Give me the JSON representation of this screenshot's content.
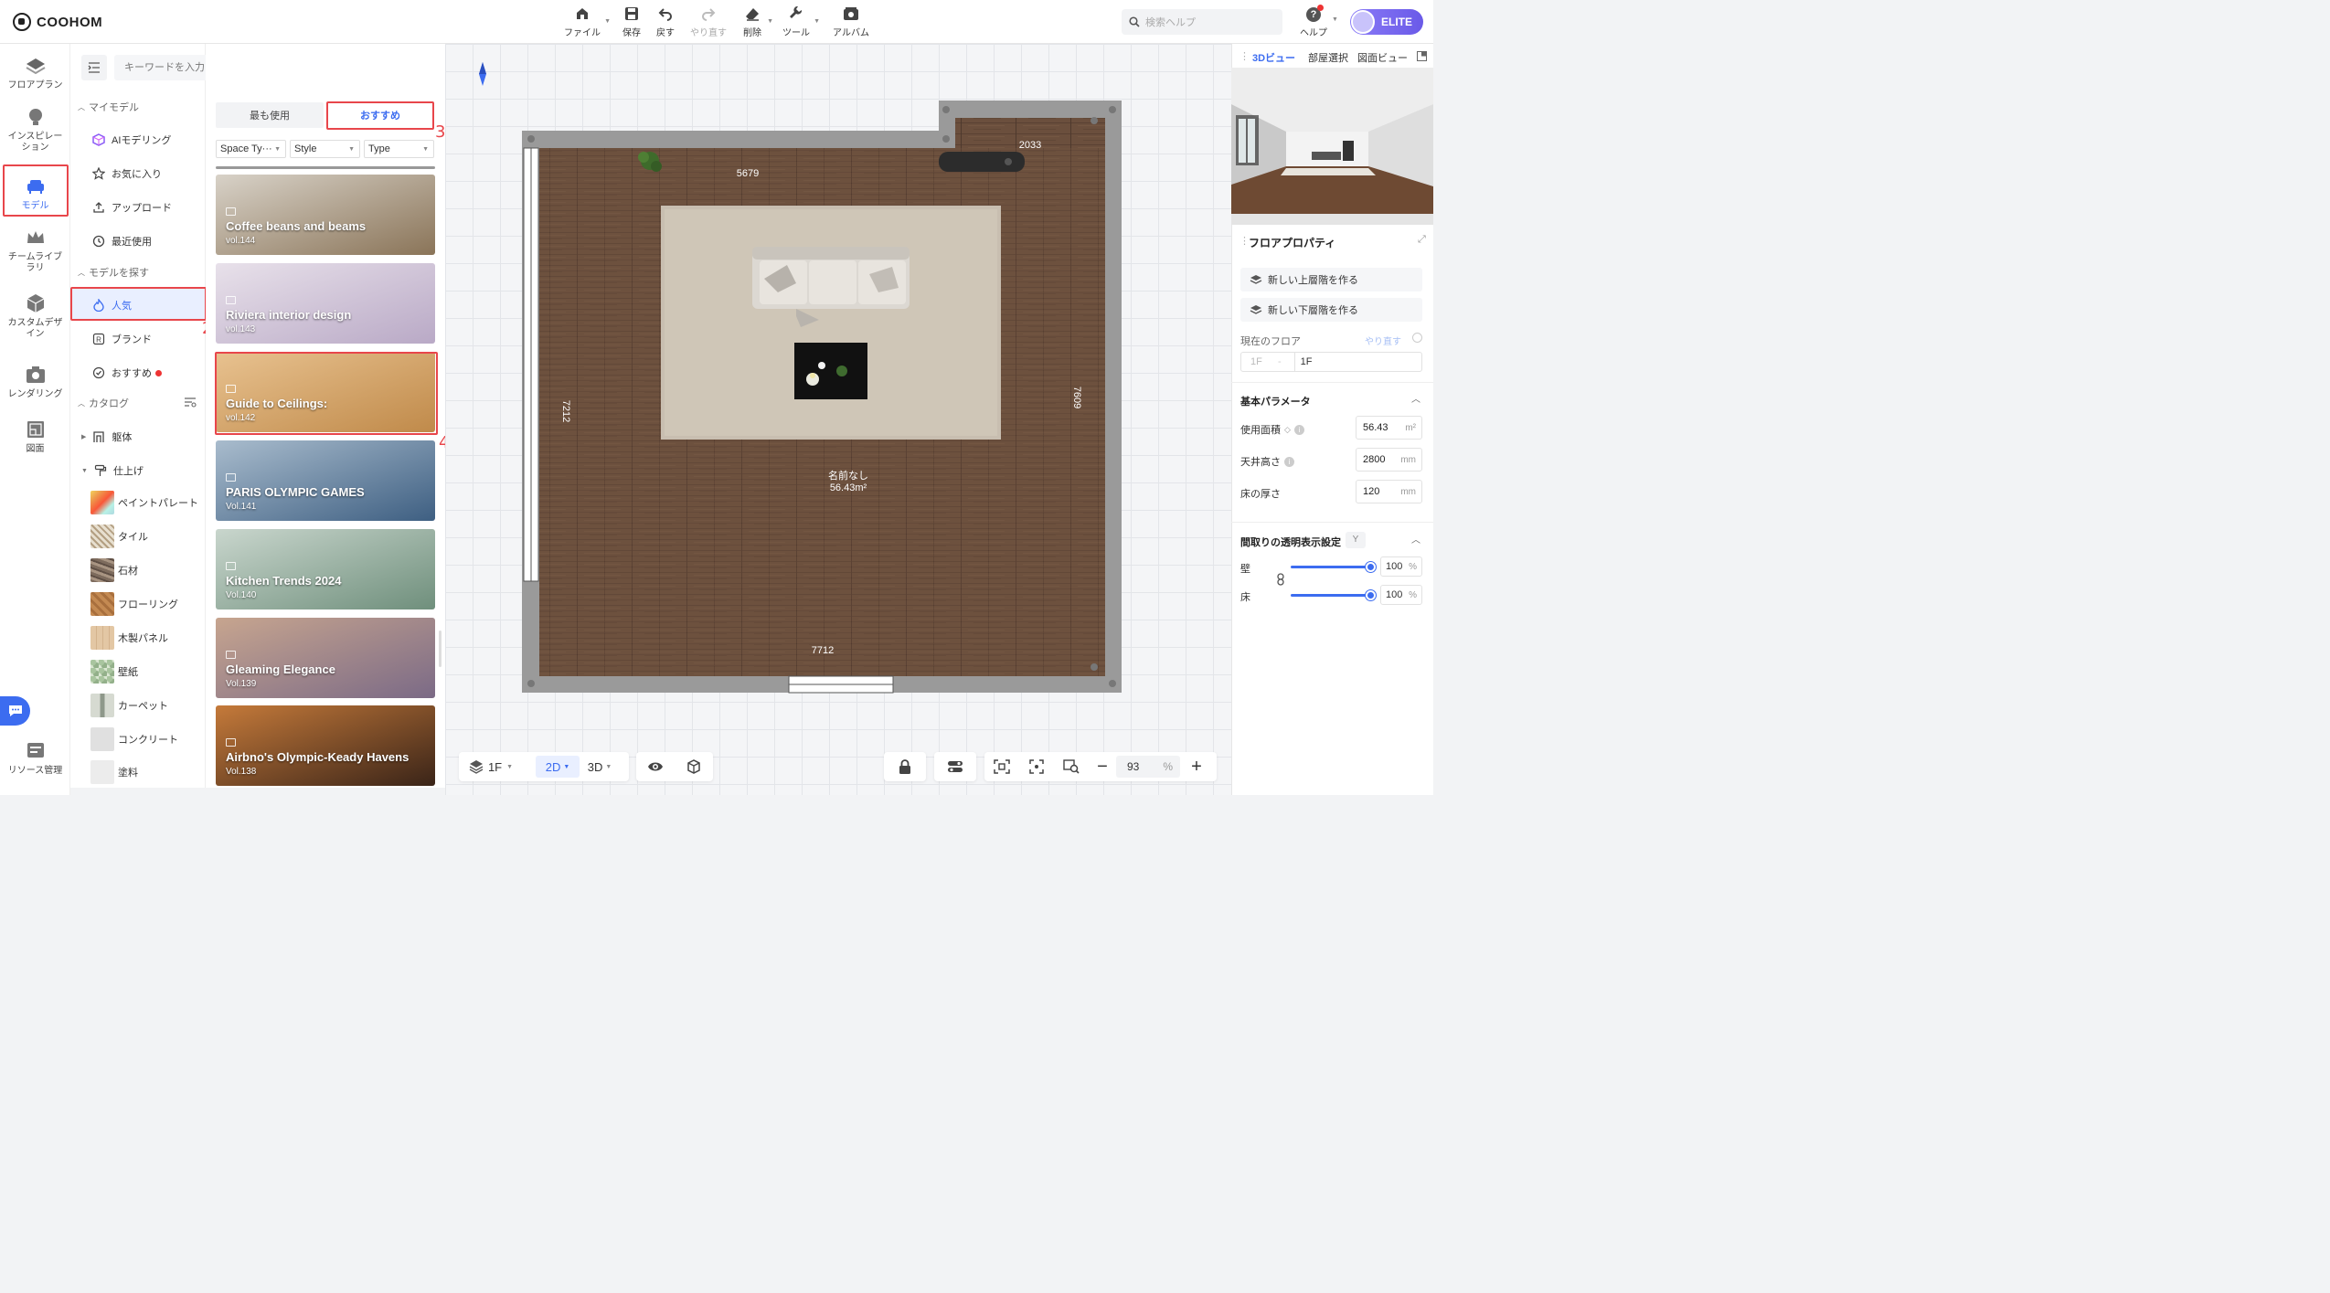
{
  "app": {
    "logo": "COOHOM"
  },
  "toolbar": {
    "file": "ファイル",
    "save": "保存",
    "undo": "戻す",
    "redo": "やり直す",
    "delete": "削除",
    "tools": "ツール",
    "album": "アルバム"
  },
  "header": {
    "help_search_placeholder": "検索ヘルプ",
    "help": "ヘルプ",
    "plan_badge": "ELITE"
  },
  "rail": {
    "items": [
      "フロアプラン",
      "インスピレーション",
      "モデル",
      "チームライブラリ",
      "カスタムデザイン",
      "レンダリング",
      "図面",
      "リソース管理"
    ]
  },
  "search": {
    "placeholder": "キーワードを入力してください"
  },
  "catalog": {
    "my_models_head": "マイモデル",
    "my_models": [
      "AIモデリング",
      "お気に入り",
      "アップロード",
      "最近使用"
    ],
    "find_head": "モデルを探す",
    "find": [
      "人気",
      "ブランド",
      "おすすめ"
    ],
    "catalog_head": "カタログ",
    "catalog": [
      "躯体",
      "仕上げ"
    ],
    "textures": [
      "ペイントパレート",
      "タイル",
      "石材",
      "フローリング",
      "木製パネル",
      "壁紙",
      "カーペット",
      "コンクリート",
      "塗料"
    ]
  },
  "tabs": {
    "most_used": "最も使用",
    "recommended": "おすすめ"
  },
  "filters": [
    "Space Ty···",
    "Style",
    "Type"
  ],
  "cards": [
    {
      "title": "Coffee beans and beams",
      "vol": "vol.144",
      "colors": [
        "#8a7458",
        "#d8d2c8"
      ]
    },
    {
      "title": "Riviera interior design",
      "vol": "vol.143",
      "colors": [
        "#b9a9c6",
        "#e8e1ea"
      ]
    },
    {
      "title": "Guide to Ceilings:",
      "vol": "vol.142",
      "colors": [
        "#c08a4a",
        "#e8c290"
      ]
    },
    {
      "title": "PARIS OLYMPIC GAMES",
      "vol": "Vol.141",
      "colors": [
        "#3e5f82",
        "#a9bccd"
      ]
    },
    {
      "title": "Kitchen Trends 2024",
      "vol": "Vol.140",
      "colors": [
        "#6f8f7c",
        "#c9d6cd"
      ]
    },
    {
      "title": "Gleaming Elegance",
      "vol": "Vol.139",
      "colors": [
        "#7b6a86",
        "#c7a58f"
      ]
    },
    {
      "title": "Airbno's Olympic-Keady Havens",
      "vol": "Vol.138",
      "colors": [
        "#3a2418",
        "#c57a3a"
      ]
    }
  ],
  "annotations": [
    "1",
    "2",
    "3",
    "4"
  ],
  "floorplan": {
    "dims": {
      "top": "5679",
      "notch": "2033",
      "left": "7212",
      "right": "7609",
      "bottom": "7712"
    },
    "room_name": "名前なし",
    "room_area": "56.43m²"
  },
  "bottombar": {
    "floor": "1F",
    "view2d": "2D",
    "view3d": "3D",
    "zoom": "93",
    "zoom_unit": "%"
  },
  "right_panel": {
    "tabs": [
      "3Dビュー",
      "部屋選択",
      "図面ビュー"
    ],
    "floor_props_title": "フロアプロパティ",
    "new_upper": "新しい上層階を作る",
    "new_lower": "新しい下層階を作る",
    "current_floor_label": "現在のフロア",
    "redo_link": "やり直す",
    "floor_prefix": "1F",
    "floor_value": "1F",
    "basic_params": "基本パラメータ",
    "area_label": "使用面積",
    "area_value": "56.43",
    "area_unit": "m²",
    "ceiling_label": "天井高さ",
    "ceiling_value": "2800",
    "ceiling_unit": "mm",
    "floor_thick_label": "床の厚さ",
    "floor_thick_value": "120",
    "floor_thick_unit": "mm",
    "transparency_title": "間取りの透明表示設定",
    "transparency_key": "Y",
    "wall_label": "壁",
    "wall_value": "100",
    "floor_label": "床",
    "floor_value2": "100",
    "pct_unit": "%",
    "wall_level": 1.0,
    "floor_level": 1.0
  },
  "colors": {
    "accent": "#3c6cf0",
    "highlight": "#e8464b",
    "wood": "#6b4f3d"
  }
}
